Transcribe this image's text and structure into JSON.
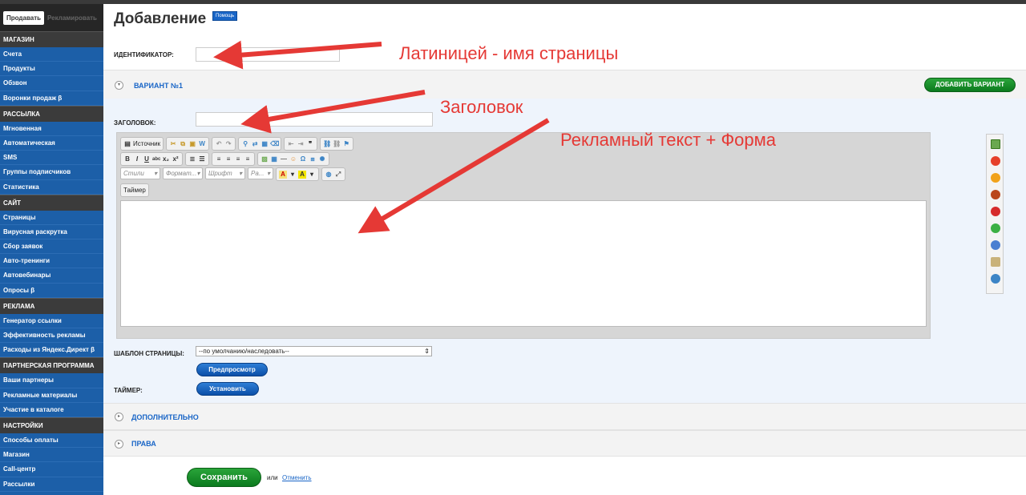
{
  "sidebar": {
    "tabs": {
      "sell": "Продавать",
      "advertise": "Рекламировать"
    },
    "sections": [
      {
        "title": "МАГАЗИН",
        "items": [
          "Счета",
          "Продукты",
          "Обзвон",
          "Воронки продаж β"
        ]
      },
      {
        "title": "РАССЫЛКА",
        "items": [
          "Мгновенная",
          "Автоматическая",
          "SMS",
          "Группы подписчиков",
          "Статистика"
        ]
      },
      {
        "title": "САЙТ",
        "items": [
          "Страницы",
          "Вирусная раскрутка",
          "Сбор заявок",
          "Авто-тренинги",
          "Автовебинары",
          "Опросы β"
        ]
      },
      {
        "title": "РЕКЛАМА",
        "items": [
          "Генератор ссылки",
          "Эффективность рекламы",
          "Расходы из Яндекс.Директ β"
        ]
      },
      {
        "title": "ПАРТНЕРСКАЯ ПРОГРАММА",
        "items": [
          "Ваши партнеры",
          "Рекламные материалы",
          "Участие в каталоге"
        ]
      },
      {
        "title": "НАСТРОЙКИ",
        "items": [
          "Способы оплаты",
          "Магазин",
          "Call-центр",
          "Рассылки"
        ]
      }
    ]
  },
  "page": {
    "title": "Добавление",
    "help": "Помощь"
  },
  "form": {
    "identifier_label": "ИДЕНТИФИКАТОР:",
    "variant_title": "ВАРИАНТ №1",
    "add_variant": "ДОБАВИТЬ ВАРИАНТ",
    "heading_label": "ЗАГОЛОВОК:",
    "template_label": "ШАБЛОН СТРАНИЦЫ:",
    "template_value": "--по умолчанию/наследовать--",
    "preview": "Предпросмотр",
    "timer_label": "ТАЙМЕР:",
    "set_button": "Установить",
    "additional": "ДОПОЛНИТЕЛЬНО",
    "rights": "ПРАВА",
    "save": "Сохранить",
    "or": "или",
    "cancel": "Отменить"
  },
  "editor": {
    "source": "Источник",
    "styles": "Стили",
    "format": "Формат...",
    "font": "Шрифт",
    "size": "Ра...",
    "timer": "Таймер"
  },
  "annotations": {
    "latin": "Латиницей - имя страницы",
    "heading": "Заголовок",
    "ad_text": "Рекламный текст + Форма"
  },
  "colors": {
    "sidebar": "#1c5fa8",
    "accent_blue": "#1a66c7",
    "green": "#1b8f2c",
    "annotation": "#e53935"
  }
}
